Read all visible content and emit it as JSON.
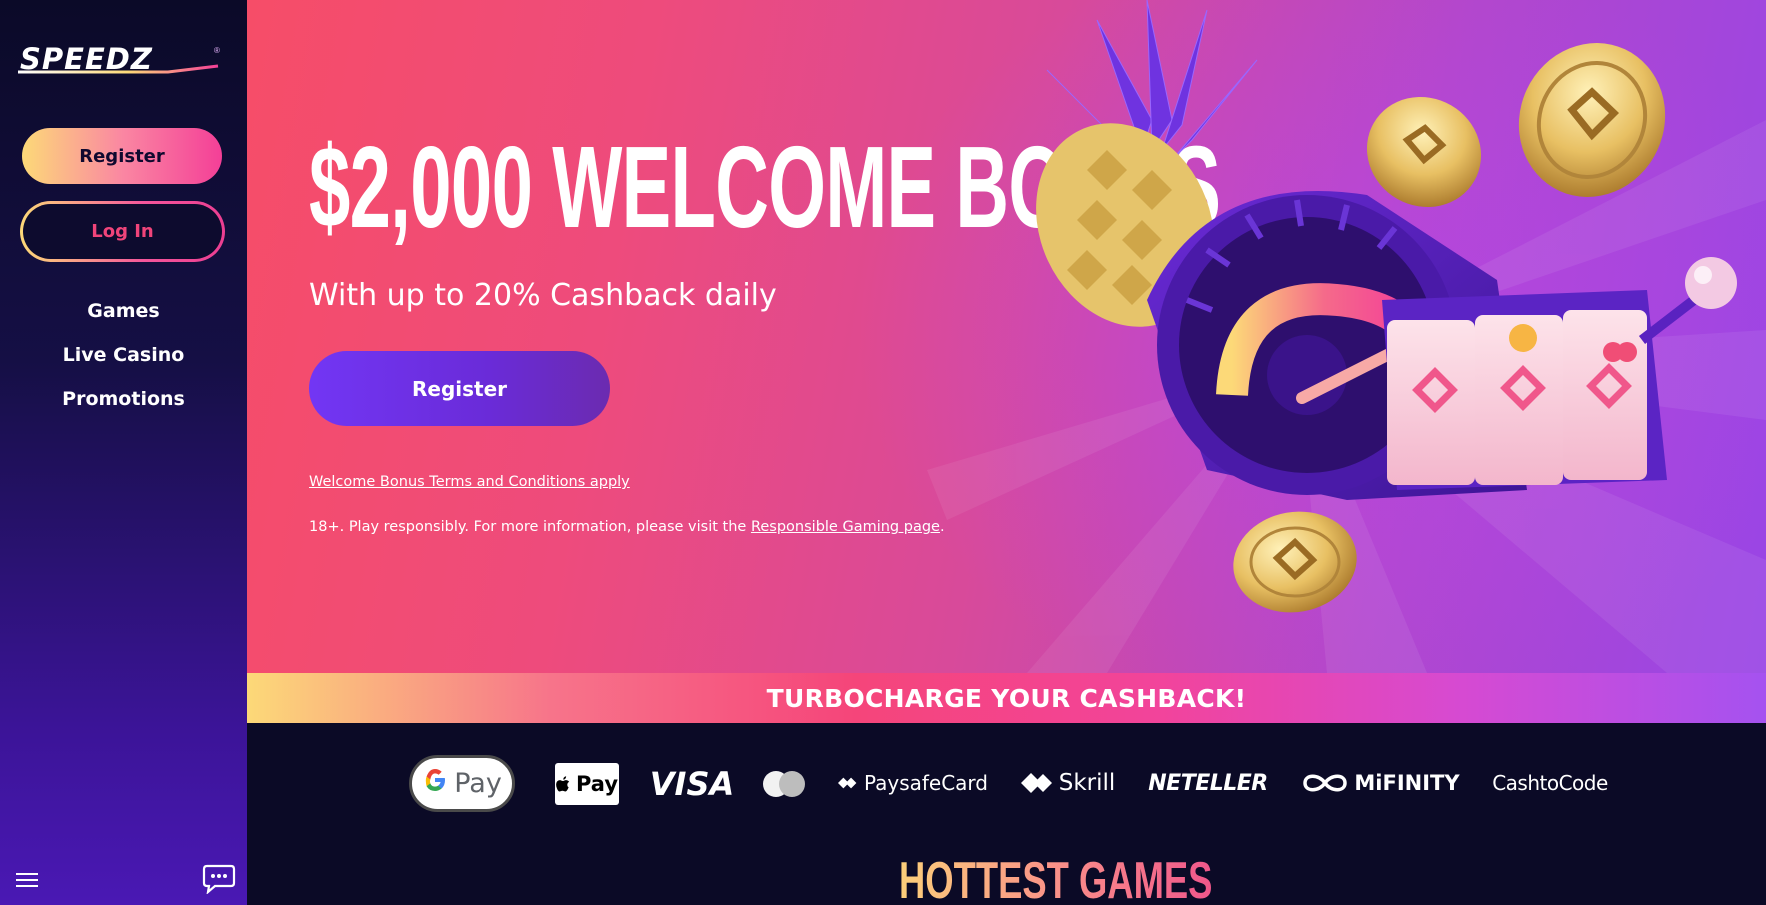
{
  "brand": {
    "name": "SPEEDZ",
    "reg_mark": "®"
  },
  "sidebar": {
    "register_label": "Register",
    "login_label": "Log In",
    "nav": [
      {
        "label": "Games"
      },
      {
        "label": "Live Casino"
      },
      {
        "label": "Promotions"
      }
    ]
  },
  "hero": {
    "title": "$2,000 WELCOME BONUS",
    "subtitle": "With up to 20% Cashback daily",
    "register_label": "Register",
    "terms_link": "Welcome Bonus Terms and Conditions apply",
    "responsible_text": "18+. Play responsibly. For more information, please visit the ",
    "responsible_link": "Responsible Gaming page",
    "responsible_end": "."
  },
  "banner": {
    "text": "TURBOCHARGE YOUR CASHBACK!"
  },
  "payments": {
    "gpay": "Pay",
    "applepay": "Pay",
    "visa": "VISA",
    "paysafecard": "PaysafeCard",
    "skrill": "Skrill",
    "neteller": "NETELLER",
    "mifinity": "MiFINITY",
    "cashtocode": "CashtoCode"
  },
  "games_section": {
    "title": "HOTTEST GAMES"
  },
  "icons": {
    "menu": "hamburger-menu-icon",
    "chat": "chat-bubble-icon"
  },
  "colors": {
    "sidebar_bg": "#0b0a28",
    "accent_pink": "#f43f97",
    "accent_yellow": "#fcd978",
    "accent_purple": "#7236f4"
  }
}
